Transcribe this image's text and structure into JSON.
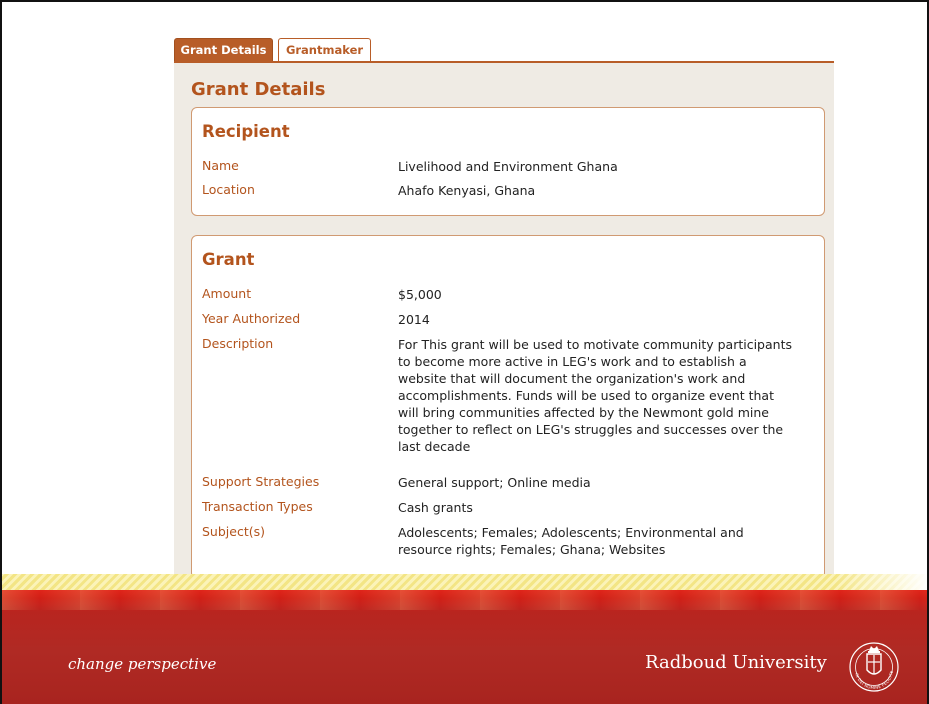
{
  "tabs": [
    {
      "label": "Grant Details",
      "active": true
    },
    {
      "label": "Grantmaker",
      "active": false
    }
  ],
  "page_title": "Grant Details",
  "recipient": {
    "title": "Recipient",
    "fields": [
      {
        "label": "Name",
        "value": "Livelihood and Environment Ghana"
      },
      {
        "label": "Location",
        "value": "Ahafo Kenyasi, Ghana"
      }
    ]
  },
  "grant": {
    "title": "Grant",
    "fields": [
      {
        "label": "Amount",
        "value": "$5,000"
      },
      {
        "label": "Year Authorized",
        "value": "2014"
      },
      {
        "label": "Description",
        "value": "For This grant will be used to motivate community participants to become more active in LEG's work and to establish a website that will document the organization's work and accomplishments. Funds will be used to organize event that will bring communities affected by the Newmont gold mine together to reflect on LEG's struggles and successes over the last decade"
      },
      {
        "label": "Support Strategies",
        "value": "General support; Online media"
      },
      {
        "label": "Transaction Types",
        "value": "Cash grants"
      },
      {
        "label": "Subject(s)",
        "value": "Adolescents; Females; Adolescents; Environmental and resource rights; Females; Ghana; Websites"
      }
    ]
  },
  "footer": {
    "tagline": "change perspective",
    "university": "Radboud University",
    "seal_icon": "radboud-seal-icon",
    "seal_text": "IN DEI NOMINE FELICITER"
  },
  "colors": {
    "accent": "#b3541d",
    "tab_active_bg": "#b85d28",
    "panel_bg": "#efebe4",
    "card_border": "#d09a72",
    "brand_red": "#b8251f",
    "stripe_yellow": "#f3e585"
  }
}
